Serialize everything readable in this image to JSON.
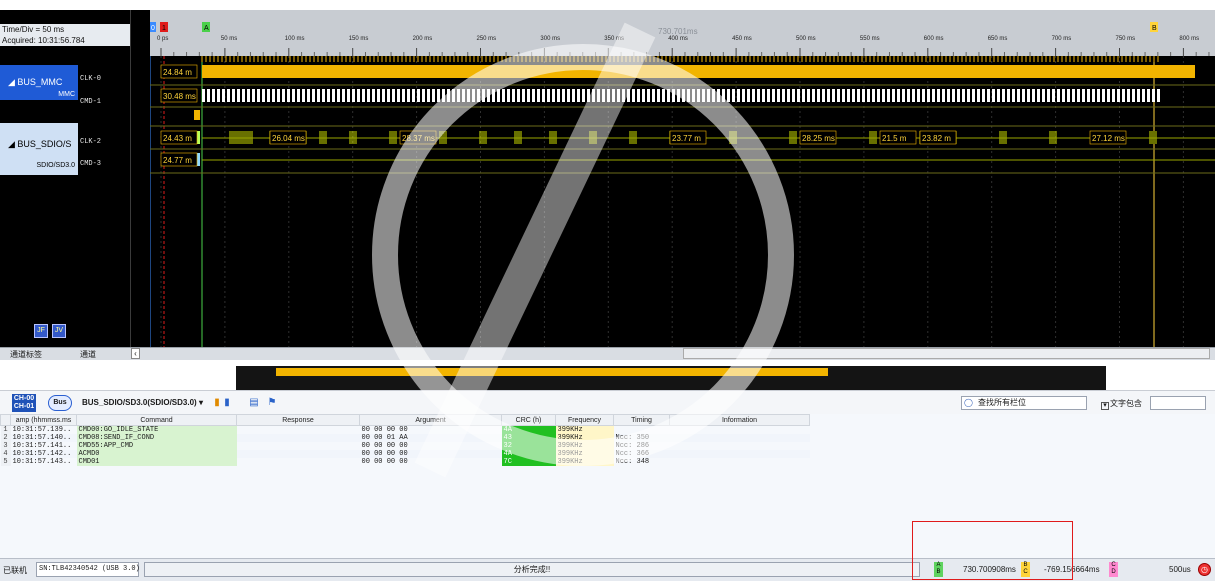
{
  "left_panel": {
    "timediv": "Time/Div = 50 ms",
    "acquired": "Acquired: 10:31:56.784",
    "buses": [
      {
        "name": "BUS_MMC",
        "sub": "MMC",
        "channels": [
          "CLK-0",
          "CMD-1"
        ]
      },
      {
        "name": "BUS_SDIO/S",
        "sub": "SDIO/SD3.0",
        "channels": [
          "CLK-2",
          "CMD-3"
        ]
      }
    ],
    "icon_a": "波形",
    "icon_b": "波形"
  },
  "ruler": {
    "ticks": [
      "0 ps",
      "50 ms",
      "100 ms",
      "150 ms",
      "200 ms",
      "250 ms",
      "300 ms",
      "350 ms",
      "400 ms",
      "450 ms",
      "500 ms",
      "550 ms",
      "600 ms",
      "650 ms",
      "700 ms",
      "750 ms",
      "800 ms"
    ],
    "marker_label": "730.701ms",
    "markers": [
      "0",
      "1",
      "A",
      "B"
    ]
  },
  "waves": {
    "clk0_label": "24.84 m",
    "cmd1_label": "30.48 ms",
    "clk2_labels": [
      "24.43 m",
      "26.04 ms",
      "28.37 ms",
      "23.77 m",
      "28.25 ms",
      "21.5 m",
      "23.82 m",
      "27.12 ms"
    ],
    "cmd3_label": "24.77 m"
  },
  "channel_bar": {
    "tag": "通道标签",
    "chan": "通道"
  },
  "protocol_bar": {
    "ch_top": "CH-00",
    "ch_bottom": "CH-01",
    "bus_label": "Bus",
    "bus_name": "BUS_SDIO/SD3.0(SDIO/SD3.0)",
    "search_placeholder": "查找所有栏位",
    "include_label": "文字包含"
  },
  "table": {
    "columns": [
      "amp (hhmmss.ms",
      "Command",
      "Response",
      "Argument",
      "CRC (h)",
      "Frequency",
      "Timing",
      "Information"
    ],
    "rows": [
      {
        "n": "1",
        "time": "10:31:57.139..",
        "command": "CMD00:GO_IDLE_STATE",
        "response": "",
        "argument": "00 00 00 00",
        "crc": "4A",
        "freq": "399KHz",
        "timing": "",
        "info": ""
      },
      {
        "n": "2",
        "time": "10:31:57.140..",
        "command": "CMD08:SEND_IF_COND",
        "response": "",
        "argument": "00 00 01 AA",
        "crc": "43",
        "freq": "399KHz",
        "timing": "Ncc: 350",
        "info": ""
      },
      {
        "n": "3",
        "time": "10:31:57.141..",
        "command": "CMD55:APP_CMD",
        "response": "",
        "argument": "00 00 00 00",
        "crc": "32",
        "freq": "399KHz",
        "timing": "Ncc: 286",
        "info": ""
      },
      {
        "n": "4",
        "time": "10:31:57.142..",
        "command": "ACMD0",
        "response": "",
        "argument": "00 00 00 00",
        "crc": "4A",
        "freq": "399KHz",
        "timing": "Ncc: 366",
        "info": ""
      },
      {
        "n": "5",
        "time": "10:31:57.143..",
        "command": "CMD01",
        "response": "",
        "argument": "00 00 00 00",
        "crc": "7C",
        "freq": "399KHz",
        "timing": "Ncc: 348",
        "info": ""
      }
    ]
  },
  "status_bar": {
    "connection": "已联机",
    "sn": "SN:TLB42340542 (USB 3.0)",
    "progress_text": "分析完成!!",
    "ab_delta": "730.700908ms",
    "bc_delta": "-769.156664ms",
    "div": "500us"
  },
  "colors": {
    "accent": "#ffc000",
    "bus_blue": "#1f5bd6",
    "crc_green": "#21c021",
    "annotation_red": "#e01b1b"
  }
}
